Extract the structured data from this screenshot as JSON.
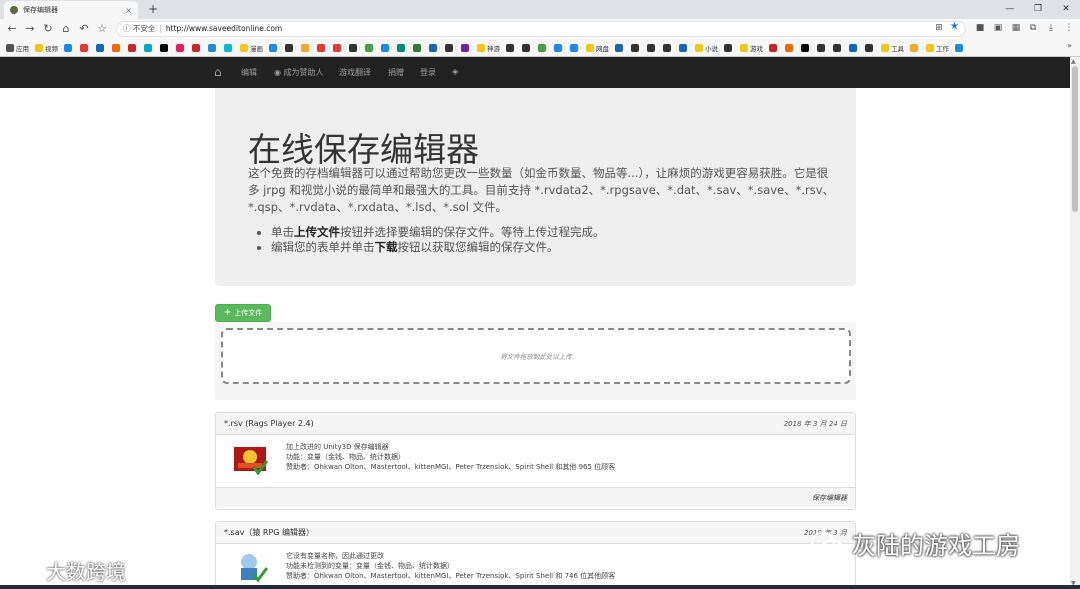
{
  "browser": {
    "tab_title": "保存编辑器",
    "tab_close": "×",
    "new_tab": "+",
    "security_label": "不安全",
    "url": "http://www.saveeditonline.com",
    "window_controls": [
      "—",
      "❐",
      "✕"
    ]
  },
  "bookmarks": [
    {
      "label": "应用",
      "color": "#555555"
    },
    {
      "label": "视频",
      "color": "#f5c518"
    },
    {
      "label": "",
      "color": "#1e88e5"
    },
    {
      "label": "",
      "color": "#e53935"
    },
    {
      "label": "",
      "color": "#1565c0"
    },
    {
      "label": "",
      "color": "#ef6c00"
    },
    {
      "label": "",
      "color": "#c62828"
    },
    {
      "label": "",
      "color": "#00acc1"
    },
    {
      "label": "",
      "color": "#000000"
    },
    {
      "label": "",
      "color": "#e91e63"
    },
    {
      "label": "",
      "color": "#c62828"
    },
    {
      "label": "",
      "color": "#1e88e5"
    },
    {
      "label": "",
      "color": "#00bcd4"
    },
    {
      "label": "漫画",
      "color": "#f5c518"
    },
    {
      "label": "",
      "color": "#1e88e5"
    },
    {
      "label": "",
      "color": "#333333"
    },
    {
      "label": "",
      "color": "#f9a825"
    },
    {
      "label": "",
      "color": "#e53935"
    },
    {
      "label": "",
      "color": "#e53935"
    },
    {
      "label": "",
      "color": "#333333"
    },
    {
      "label": "",
      "color": "#43a047"
    },
    {
      "label": "",
      "color": "#1e88e5"
    },
    {
      "label": "",
      "color": "#00897b"
    },
    {
      "label": "",
      "color": "#2e7d32"
    },
    {
      "label": "",
      "color": "#1565c0"
    },
    {
      "label": "",
      "color": "#333333"
    },
    {
      "label": "",
      "color": "#7b1fa2"
    },
    {
      "label": "神游",
      "color": "#f5c518"
    },
    {
      "label": "",
      "color": "#333333"
    },
    {
      "label": "",
      "color": "#333333"
    },
    {
      "label": "",
      "color": "#43a047"
    },
    {
      "label": "",
      "color": "#1e88e5"
    },
    {
      "label": "",
      "color": "#1e88e5"
    },
    {
      "label": "网盘",
      "color": "#f5c518"
    },
    {
      "label": "",
      "color": "#1565c0"
    },
    {
      "label": "",
      "color": "#333333"
    },
    {
      "label": "",
      "color": "#333333"
    },
    {
      "label": "",
      "color": "#333333"
    },
    {
      "label": "",
      "color": "#1565c0"
    },
    {
      "label": "小说",
      "color": "#f5c518"
    },
    {
      "label": "",
      "color": "#333333"
    },
    {
      "label": "游戏",
      "color": "#f5c518"
    },
    {
      "label": "",
      "color": "#c62828"
    },
    {
      "label": "",
      "color": "#ef6c00"
    },
    {
      "label": "",
      "color": "#000000"
    },
    {
      "label": "",
      "color": "#333333"
    },
    {
      "label": "",
      "color": "#333333"
    },
    {
      "label": "",
      "color": "#1565c0"
    },
    {
      "label": "",
      "color": "#333333"
    },
    {
      "label": "工具",
      "color": "#f5c518"
    },
    {
      "label": "",
      "color": "#f9a825"
    },
    {
      "label": "工作",
      "color": "#f5c518"
    },
    {
      "label": "",
      "color": "#1e88e5"
    }
  ],
  "bookmarks_more": "»",
  "nav": {
    "home_icon": "home-icon",
    "links": [
      "编辑",
      "成为赞助人",
      "游戏翻译",
      "捐赠",
      "登录"
    ]
  },
  "jumbotron": {
    "title": "在线保存编辑器",
    "description": "这个免费的存档编辑器可以通过帮助您更改一些数量（如金币数量、物品等...），让麻烦的游戏更容易获胜。它是很多 jrpg 和视觉小说的最简单和最强大的工具。目前支持 *.rvdata2、*.rpgsave、*.dat、*.sav、*.save、*.rsv、*.qsp、*.rvdata、*.rxdata、*.lsd、*.sol 文件。",
    "bullet1": {
      "pre": "单击",
      "bold": "上传文件",
      "post": "按钮并选择要编辑的保存文件。等待上传过程完成。"
    },
    "bullet2": {
      "pre": "编辑您的表单并单击",
      "bold": "下载",
      "post": "按钮以获取您编辑的保存文件。"
    }
  },
  "upload": {
    "button_label": "上传文件",
    "dropzone_text": "将文件拖放到此处以上传"
  },
  "editors": [
    {
      "header": "*.rsv (Rags Player 2.4)",
      "date": "2018 年 3 月 24 日",
      "lines": [
        "加上改进的 Unity3D 保存编辑器",
        "功能：变量（金钱、物品、统计数据）",
        "赞助者：Ohkwan Olton、Mastertool、kittenMGI、Peter Trzensiok、Spirit Shell 和其他 965 位顾客"
      ],
      "footer": "保存编辑器"
    },
    {
      "header": "*.sav（猿 RPG 编辑器）",
      "date": "2018 年 3 月",
      "lines": [
        "它没有变量名称，因此通过更改",
        "功能未检测到的变量：变量（金钱、物品、统计数据）",
        "赞助者：Ohkwan Olton、Mastertool、kittenMGI、Peter Trzensiok、Spirit Shell 和 746 位其他顾客"
      ]
    }
  ],
  "watermarks": {
    "left": "大数跨境",
    "right": "灰陆的游戏工房"
  }
}
